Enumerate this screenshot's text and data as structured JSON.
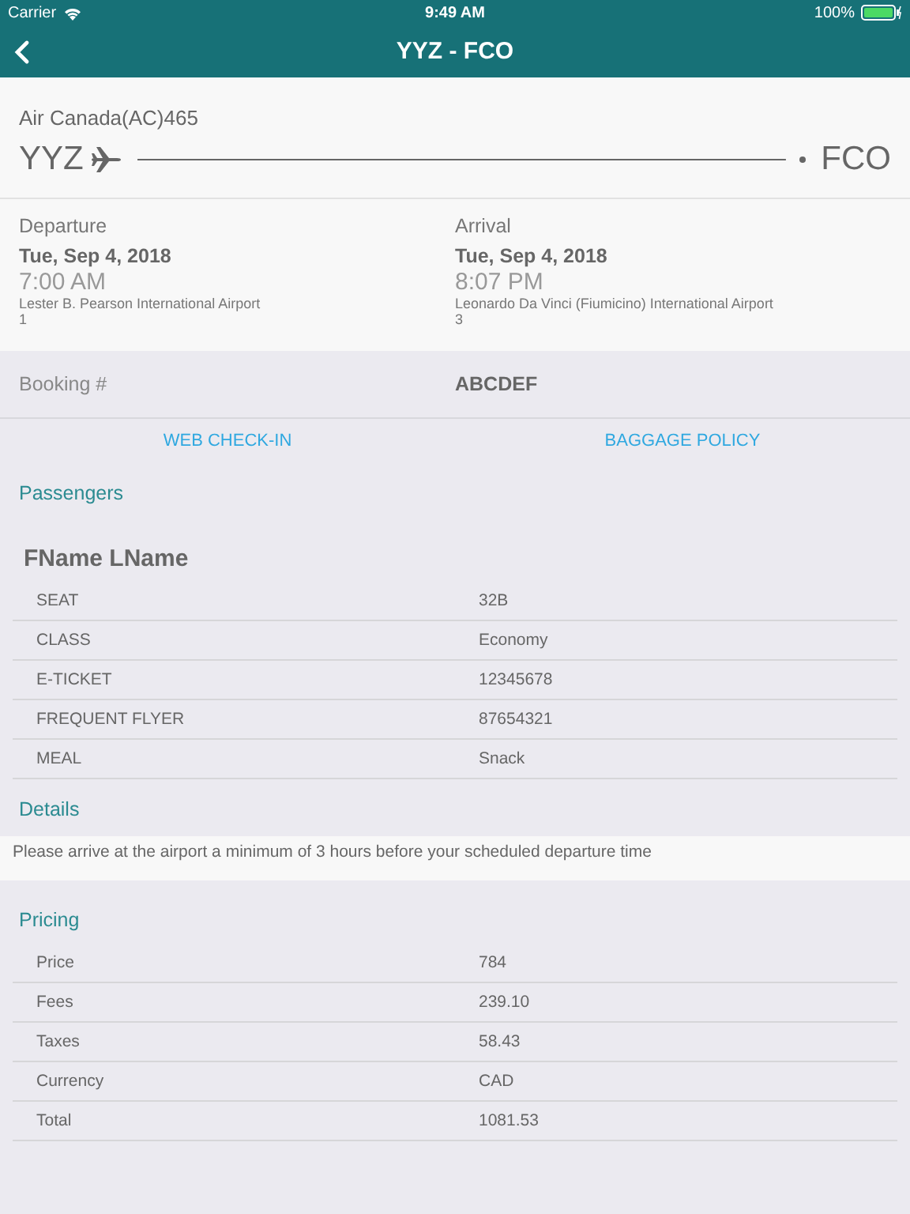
{
  "status_bar": {
    "carrier": "Carrier",
    "time": "9:49 AM",
    "battery": "100%"
  },
  "nav": {
    "title": "YYZ - FCO"
  },
  "flight": {
    "airline": "Air Canada(AC)465",
    "origin": "YYZ",
    "destination": "FCO"
  },
  "legs": [
    {
      "label": "Departure",
      "date": "Tue, Sep 4, 2018",
      "time": "7:00 AM",
      "airport": "Lester B. Pearson International Airport",
      "terminal": "1"
    },
    {
      "label": "Arrival",
      "date": "Tue, Sep 4, 2018",
      "time": "8:07 PM",
      "airport": "Leonardo Da Vinci (Fiumicino) International Airport",
      "terminal": "3"
    }
  ],
  "booking": {
    "label": "Booking #",
    "value": "ABCDEF"
  },
  "actions": [
    "WEB CHECK-IN",
    "BAGGAGE POLICY"
  ],
  "passengers": {
    "heading": "Passengers",
    "name": "FName LName",
    "rows": [
      {
        "label": "SEAT",
        "value": "32B"
      },
      {
        "label": "CLASS",
        "value": "Economy"
      },
      {
        "label": "E-TICKET",
        "value": "12345678"
      },
      {
        "label": "FREQUENT FLYER",
        "value": "87654321"
      },
      {
        "label": "MEAL",
        "value": "Snack"
      }
    ]
  },
  "details": {
    "heading": "Details",
    "text": "Please arrive at the airport a minimum of 3 hours before your scheduled departure time"
  },
  "pricing": {
    "heading": "Pricing",
    "rows": [
      {
        "label": "Price",
        "value": "784"
      },
      {
        "label": "Fees",
        "value": "239.10"
      },
      {
        "label": "Taxes",
        "value": "58.43"
      },
      {
        "label": "Currency",
        "value": "CAD"
      },
      {
        "label": "Total",
        "value": "1081.53"
      }
    ]
  }
}
